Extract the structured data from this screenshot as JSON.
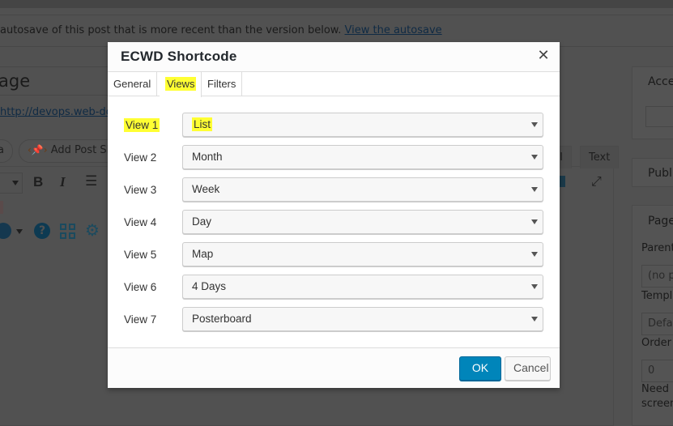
{
  "background": {
    "notice_text": "autosave of this post that is more recent than the version below.",
    "notice_link": "View the autosave",
    "page_title_fragment": "age",
    "permalink_fragment": "http://devops.web-dorad",
    "media_button_fragment": "a",
    "add_post_slider_label": "Add Post Slide",
    "editor_tabs": [
      "ual",
      "Text"
    ],
    "toolbar_icons": [
      "bold-icon",
      "italic-icon",
      "bulleted-list-icon",
      "help-icon",
      "grid-icon",
      "gear-icon",
      "fullscreen-icon"
    ],
    "sidebar": {
      "box1_title": "Acce",
      "box2_title": "Publi",
      "box3_title": "Page",
      "parent_label": "Parent",
      "parent_value": "(no pa",
      "template_label": "Templa",
      "template_value": "Defau",
      "order_label": "Order",
      "order_value": "0",
      "help_line1": "Need h",
      "help_line2": "screen"
    }
  },
  "modal": {
    "title": "ECWD Shortcode",
    "close_icon": "close-icon",
    "tabs": [
      {
        "label": "General",
        "active": false
      },
      {
        "label": "Views",
        "active": true,
        "highlighted": true
      },
      {
        "label": "Filters",
        "active": false
      }
    ],
    "views": [
      {
        "label": "View 1",
        "value": "List",
        "highlighted": true
      },
      {
        "label": "View 2",
        "value": "Month"
      },
      {
        "label": "View 3",
        "value": "Week"
      },
      {
        "label": "View 4",
        "value": "Day"
      },
      {
        "label": "View 5",
        "value": "Map"
      },
      {
        "label": "View 6",
        "value": "4 Days"
      },
      {
        "label": "View 7",
        "value": "Posterboard"
      }
    ],
    "ok_label": "OK",
    "cancel_label": "Cancel"
  },
  "colors": {
    "primary_button": "#0085ba",
    "highlight": "#ffff33",
    "overlay": "#515151"
  }
}
